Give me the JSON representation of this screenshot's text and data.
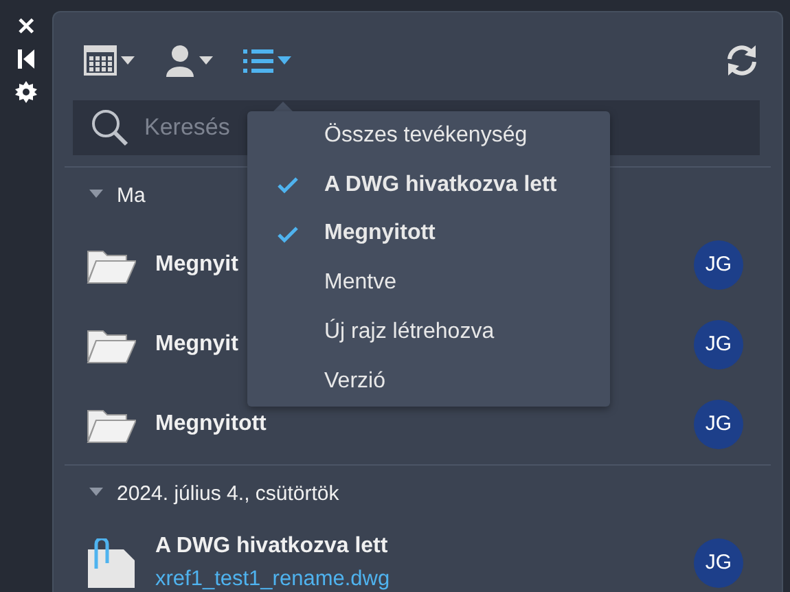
{
  "side_buttons": [
    {
      "kind": "close",
      "label": "✕"
    },
    {
      "kind": "collapse"
    },
    {
      "kind": "settings"
    }
  ],
  "toolbar": {
    "buttons": [
      {
        "kind": "calendar",
        "active": false
      },
      {
        "kind": "user",
        "active": false
      },
      {
        "kind": "list",
        "active": true
      }
    ]
  },
  "search": {
    "placeholder": "Keresés"
  },
  "groups": [
    {
      "title": "Ma",
      "expanded": true,
      "items": [
        {
          "kind": "opened",
          "title": "Megnyit",
          "avatar": "JG"
        },
        {
          "kind": "opened",
          "title": "Megnyit",
          "avatar": "JG"
        },
        {
          "kind": "opened",
          "title": "Megnyitott",
          "avatar": "JG"
        }
      ]
    },
    {
      "title": "2024. július 4., csütörtök",
      "expanded": true,
      "items": [
        {
          "kind": "referenced",
          "title": "A DWG hivatkozva lett",
          "file": "xref1_test1_rename.dwg",
          "avatar": "JG"
        }
      ]
    }
  ],
  "filter_menu": {
    "items": [
      {
        "label": "Összes tevékenység",
        "checked": false
      },
      {
        "label": "A DWG hivatkozva lett",
        "checked": true
      },
      {
        "label": "Megnyitott",
        "checked": true
      },
      {
        "label": "Mentve",
        "checked": false
      },
      {
        "label": "Új rajz létrehozva",
        "checked": false
      },
      {
        "label": "Verzió",
        "checked": false
      }
    ]
  }
}
